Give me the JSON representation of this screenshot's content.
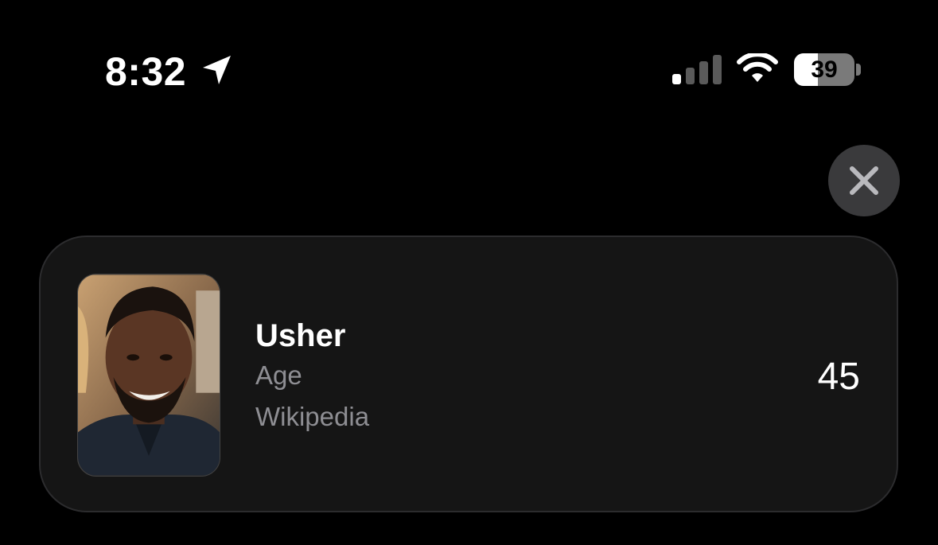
{
  "status_bar": {
    "time": "8:32",
    "battery_level": 39,
    "battery_text": "39",
    "location_icon": "location-arrow-icon",
    "signal_icon": "cellular-signal-icon",
    "wifi_icon": "wifi-icon"
  },
  "close_button": {
    "icon": "close-icon"
  },
  "result_card": {
    "name": "Usher",
    "subtitle": "Age",
    "source": "Wikipedia",
    "value": "45",
    "image_icon": "person-photo"
  },
  "colors": {
    "background": "#000000",
    "card": "#151515",
    "secondary_text": "#8e8e93",
    "close_button_bg": "#3a3a3c"
  }
}
